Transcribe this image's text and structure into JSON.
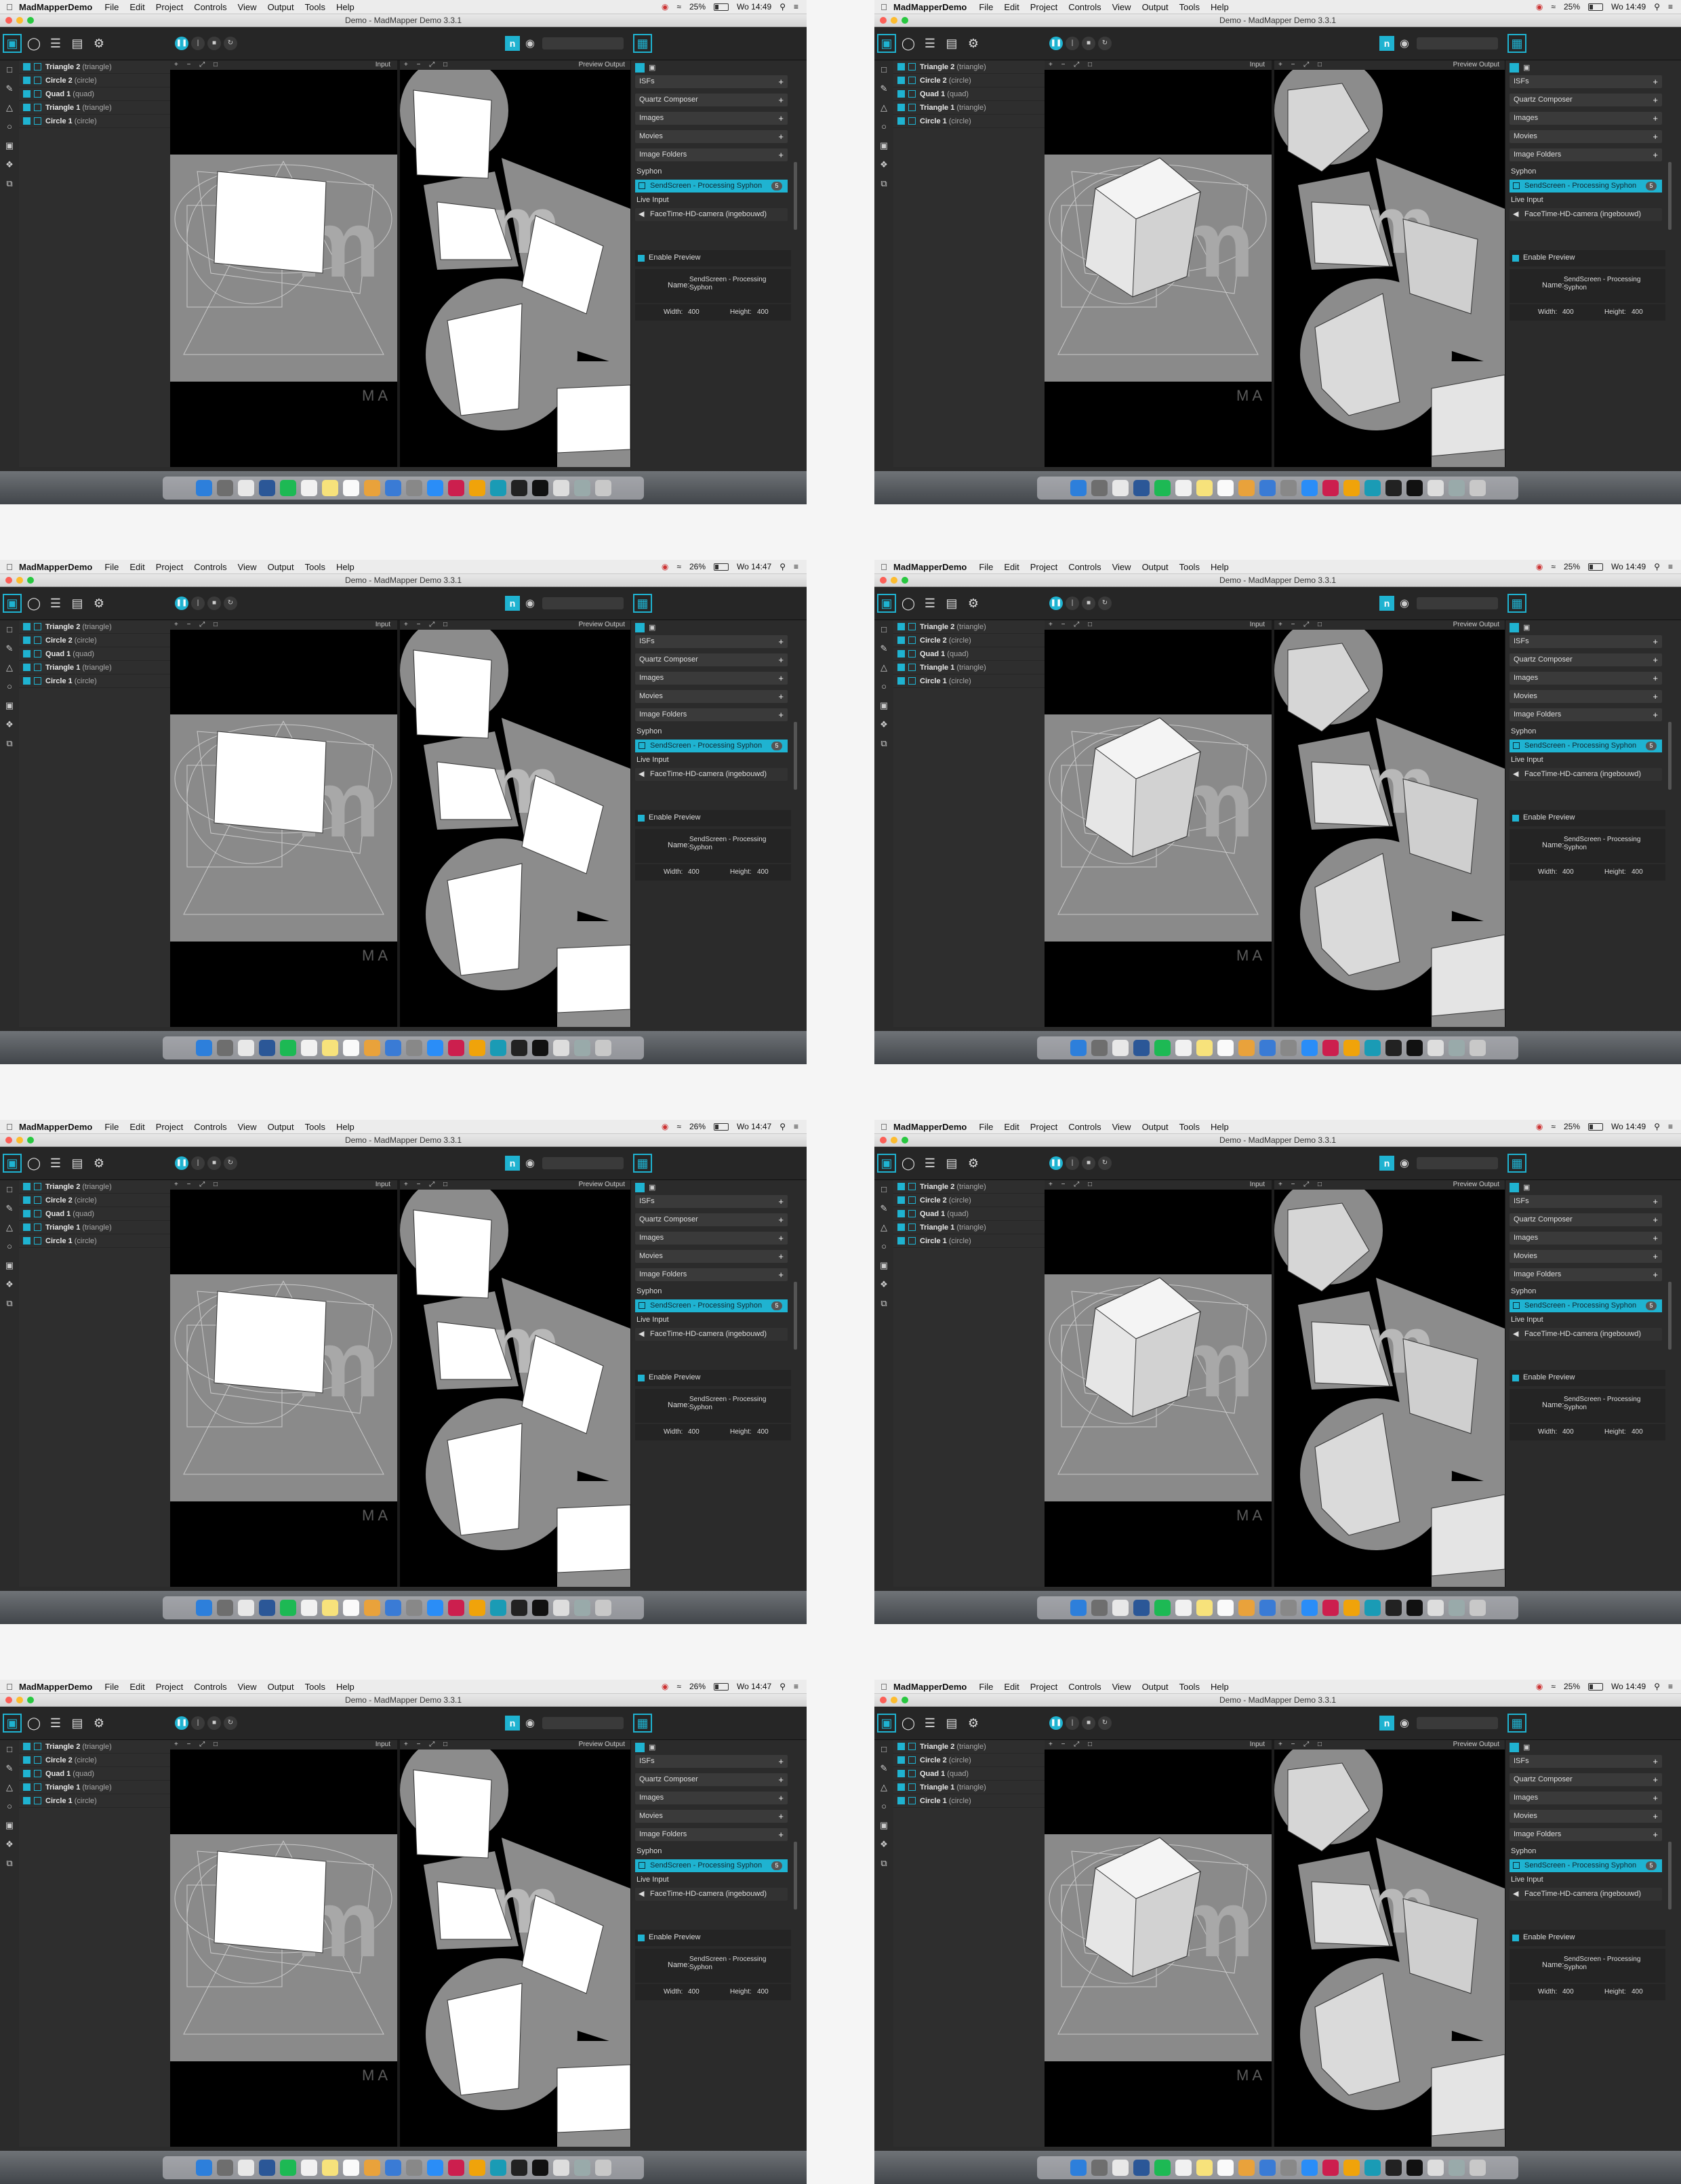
{
  "menubar": {
    "apple": "",
    "app_name": "MadMapperDemo",
    "items": [
      "File",
      "Edit",
      "Project",
      "Controls",
      "View",
      "Output",
      "Tools",
      "Help"
    ],
    "wifi_icon": "wifi-icon",
    "search_icon": "search-icon"
  },
  "window_title": "Demo - MadMapper Demo 3.3.1",
  "layers": [
    {
      "name": "Triangle 2",
      "type": "(triangle)"
    },
    {
      "name": "Circle 2",
      "type": "(circle)"
    },
    {
      "name": "Quad 1",
      "type": "(quad)"
    },
    {
      "name": "Triangle 1",
      "type": "(triangle)"
    },
    {
      "name": "Circle 1",
      "type": "(circle)"
    }
  ],
  "input_label": "Input",
  "preview_output_label": "Preview Output",
  "watermark_text": "MA",
  "sources": {
    "isfs": "ISFs",
    "quartz": "Quartz Composer",
    "images": "Images",
    "movies": "Movies",
    "image_folders": "Image Folders",
    "syphon_header": "Syphon",
    "syphon_item": "SendScreen - Processing Syphon",
    "syphon_count": "5",
    "live_input_header": "Live Input",
    "camera": "FaceTime-HD-camera (ingebouwd)"
  },
  "preview": {
    "enable_label": "Enable Preview",
    "name_label": "Name:",
    "name_value_1": "SendScreen - Processing",
    "name_value_2": "Syphon",
    "width_label": "Width:",
    "width_value": "400",
    "height_label": "Height:",
    "height_value": "400"
  },
  "screens": [
    {
      "battery": "25%",
      "clock": "Wo 14:49",
      "style": "flat"
    },
    {
      "battery": "25%",
      "clock": "Wo 14:49",
      "style": "cube"
    },
    {
      "battery": "26%",
      "clock": "Wo 14:47",
      "style": "flat"
    },
    {
      "battery": "25%",
      "clock": "Wo 14:49",
      "style": "cube"
    },
    {
      "battery": "26%",
      "clock": "Wo 14:47",
      "style": "flat"
    },
    {
      "battery": "25%",
      "clock": "Wo 14:49",
      "style": "cube"
    },
    {
      "battery": "26%",
      "clock": "Wo 14:47",
      "style": "flat"
    },
    {
      "battery": "25%",
      "clock": "Wo 14:49",
      "style": "cube"
    }
  ],
  "colors": {
    "accent": "#1fb3d1",
    "panel": "#2b2b2b",
    "canvas": "#000000"
  }
}
